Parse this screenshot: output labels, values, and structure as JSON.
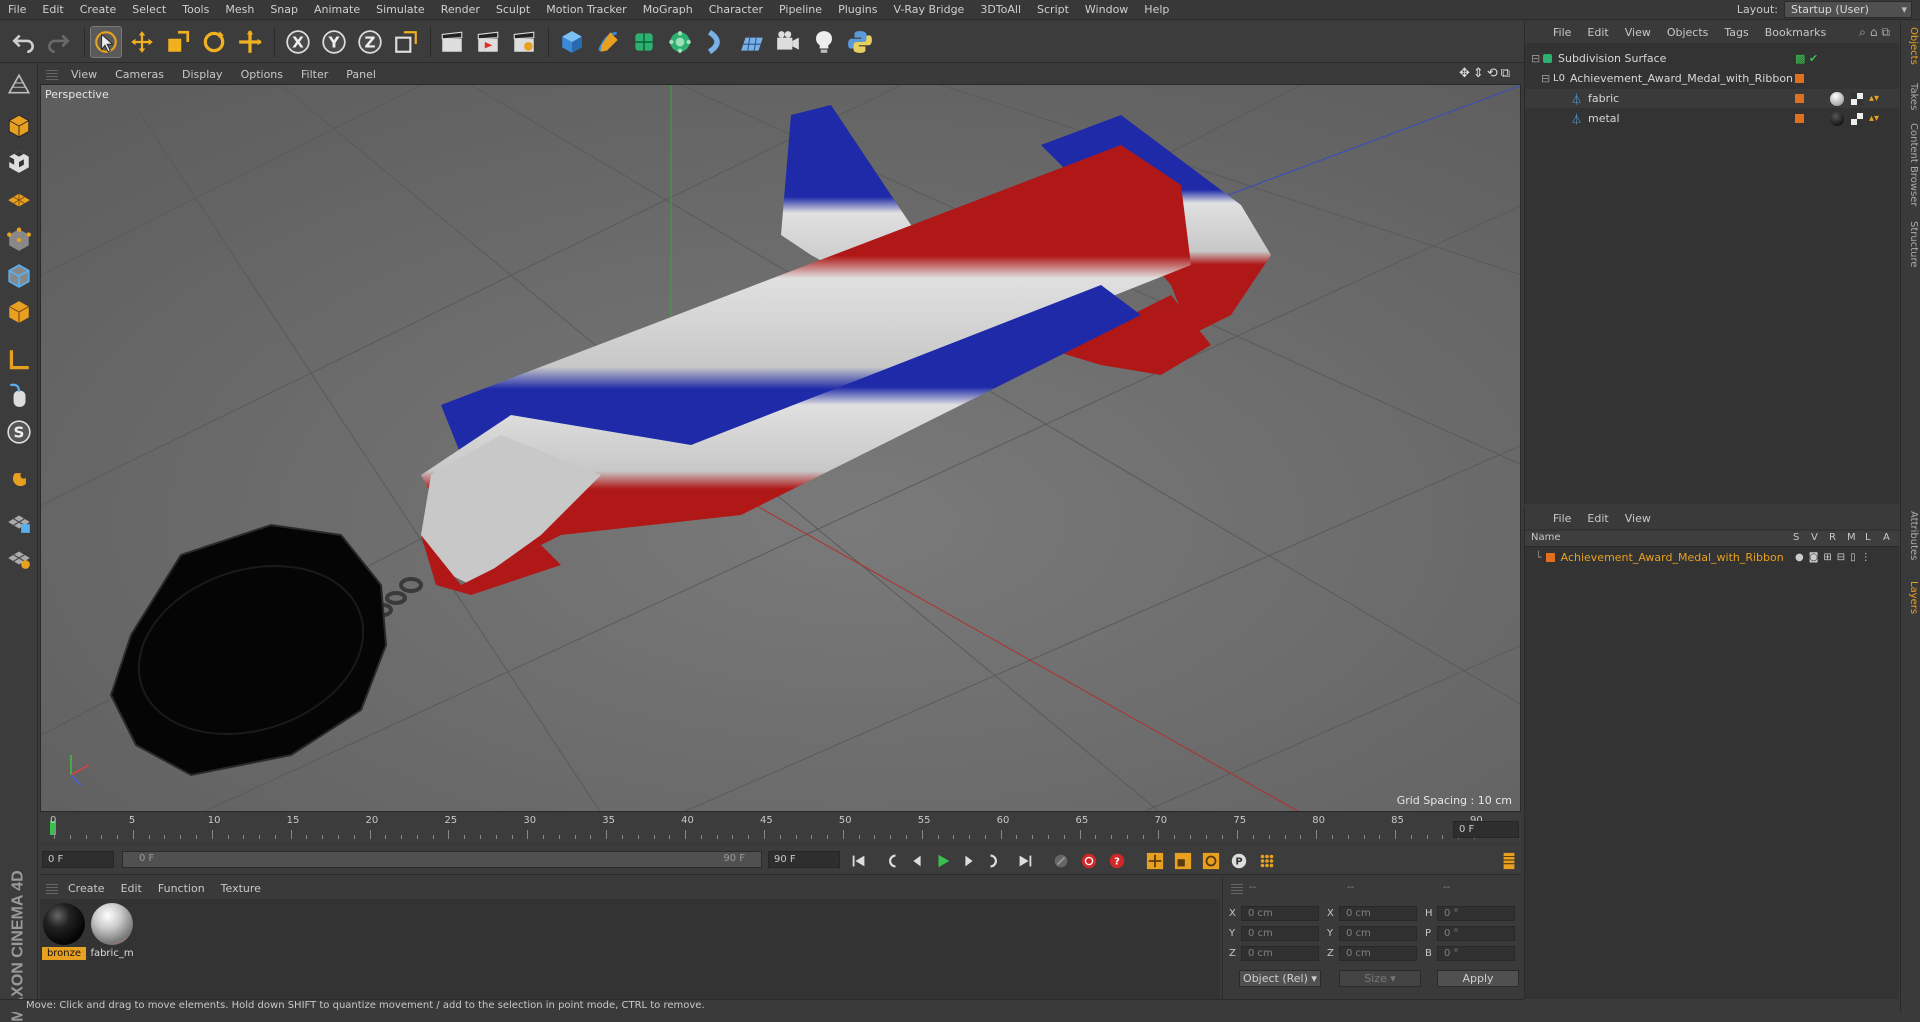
{
  "menu": [
    "File",
    "Edit",
    "Create",
    "Select",
    "Tools",
    "Mesh",
    "Snap",
    "Animate",
    "Simulate",
    "Render",
    "Sculpt",
    "Motion Tracker",
    "MoGraph",
    "Character",
    "Pipeline",
    "Plugins",
    "V-Ray Bridge",
    "3DToAll",
    "Script",
    "Window",
    "Help"
  ],
  "layout": {
    "label": "Layout:",
    "value": "Startup (User)"
  },
  "viewport": {
    "menu": [
      "View",
      "Cameras",
      "Display",
      "Options",
      "Filter",
      "Panel"
    ],
    "camera_label": "Perspective",
    "grid_spacing": "Grid Spacing : 10 cm"
  },
  "timeline": {
    "ticks": [
      "0",
      "5",
      "10",
      "15",
      "20",
      "25",
      "30",
      "35",
      "40",
      "45",
      "50",
      "55",
      "60",
      "65",
      "70",
      "75",
      "80",
      "85",
      "90"
    ],
    "end_field": "0 F",
    "start_field": "0 F",
    "range_start": "0 F",
    "range_end": "90 F",
    "max_field": "90 F"
  },
  "materials": {
    "menu": [
      "Create",
      "Edit",
      "Function",
      "Texture"
    ],
    "items": [
      {
        "name": "bronze",
        "color": "#1a1a1a"
      },
      {
        "name": "fabric_m",
        "color": "#c0c0c0"
      }
    ]
  },
  "coordinates": {
    "header": [
      "--",
      "--",
      "--"
    ],
    "rows": [
      {
        "a": "X",
        "av": "0 cm",
        "b": "X",
        "bv": "0 cm",
        "c": "H",
        "cv": "0 °"
      },
      {
        "a": "Y",
        "av": "0 cm",
        "b": "Y",
        "bv": "0 cm",
        "c": "P",
        "cv": "0 °"
      },
      {
        "a": "Z",
        "av": "0 cm",
        "b": "Z",
        "bv": "0 cm",
        "c": "B",
        "cv": "0 °"
      }
    ],
    "mode": "Object (Rel)",
    "size": "Size",
    "apply": "Apply"
  },
  "status": "Move: Click and drag to move elements. Hold down SHIFT to quantize movement / add to the selection in point mode, CTRL to remove.",
  "objects": {
    "menu": [
      "File",
      "Edit",
      "View",
      "Objects",
      "Tags",
      "Bookmarks"
    ],
    "tree": [
      {
        "name": "Subdivision Surface",
        "level": 0
      },
      {
        "name": "Achievement_Award_Medal_with_Ribbon",
        "level": 1
      },
      {
        "name": "fabric",
        "level": 2
      },
      {
        "name": "metal",
        "level": 2
      }
    ]
  },
  "layers": {
    "menu": [
      "File",
      "Edit",
      "View"
    ],
    "columns": [
      "Name",
      "S",
      "V",
      "R",
      "M",
      "L",
      "A"
    ],
    "items": [
      {
        "name": "Achievement_Award_Medal_with_Ribbon",
        "color": "#e07020"
      }
    ]
  },
  "right_tabs": [
    "Objects",
    "Takes",
    "Content Browser",
    "Structure",
    "Attributes",
    "Layers"
  ]
}
